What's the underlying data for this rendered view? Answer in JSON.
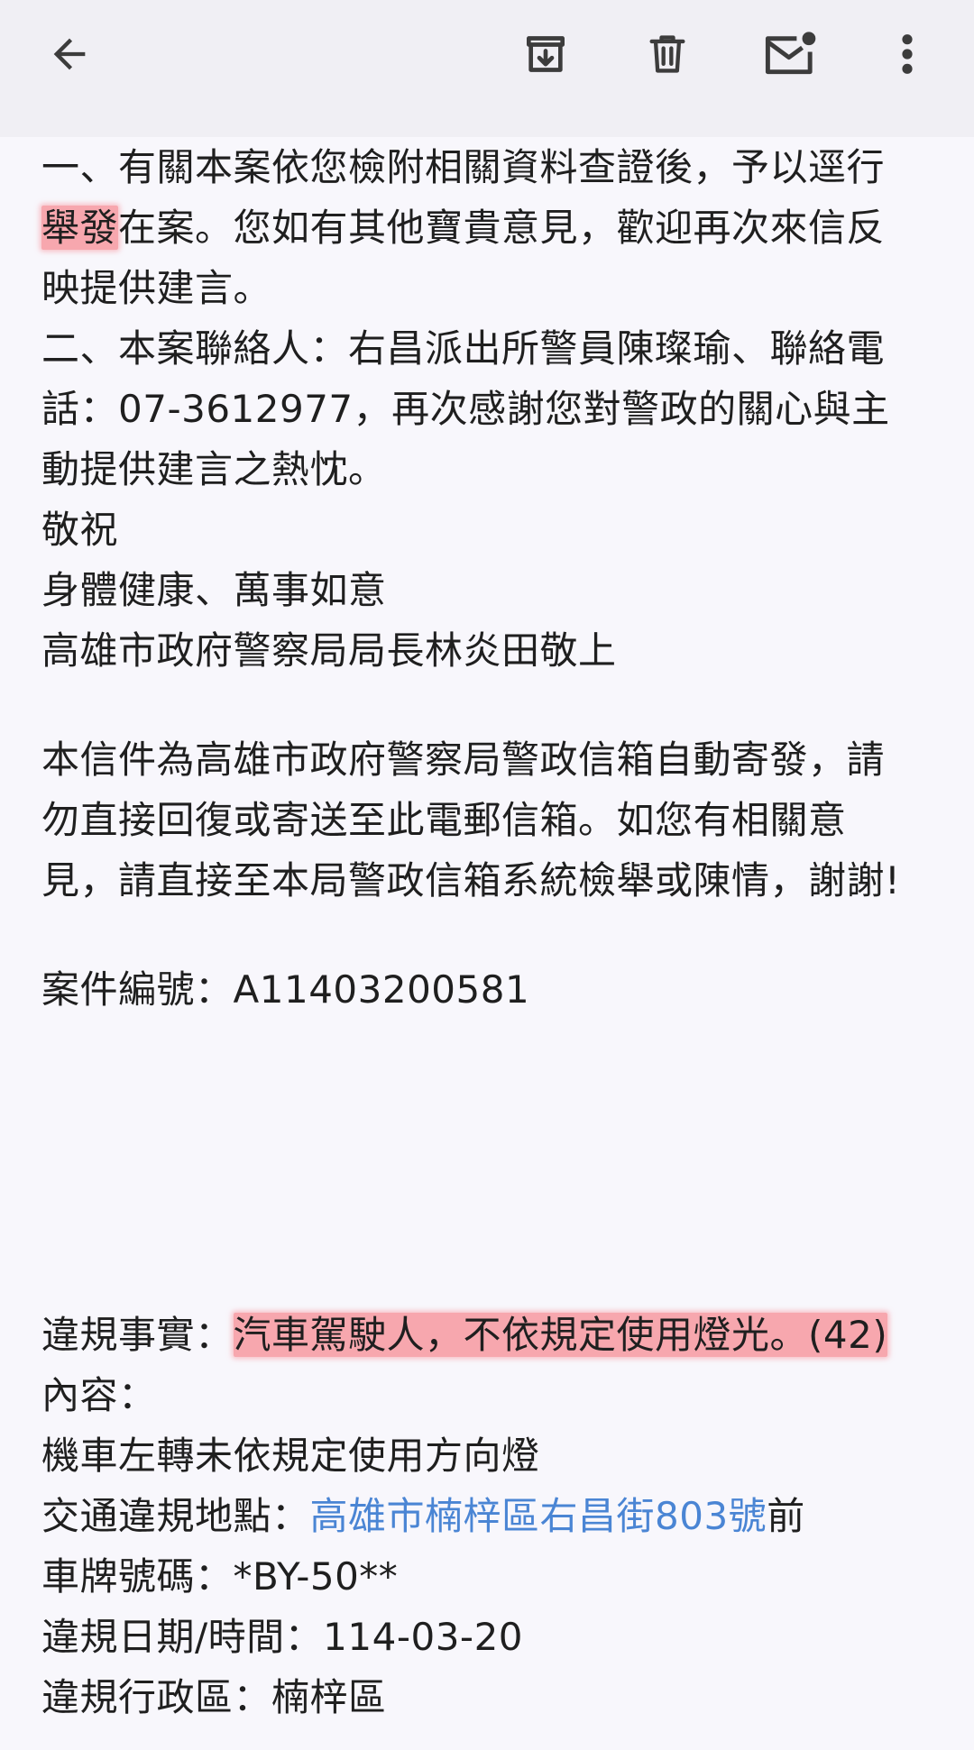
{
  "toolbar": {
    "back_icon": "arrow-left-icon",
    "archive_icon": "archive-icon",
    "delete_icon": "trash-icon",
    "mark_unread_icon": "mail-unread-icon",
    "more_icon": "more-vert-icon"
  },
  "colors": {
    "toolbar_bg": "#f0eff4",
    "page_bg": "#f8f7fc",
    "highlight": "#f7a7ae",
    "link": "#4a85d4"
  },
  "body": {
    "p1_line1": "一、有關本案依您檢附相關資料查證後，予以逕行",
    "p1_line2_hl": "舉發",
    "p1_line2_rest": "在案。您如有其他寶貴意見，歡迎再次來信反",
    "p1_line3": "映提供建言。",
    "p2_line1": "二、本案聯絡人：右昌派出所警員陳璨瑜、聯絡電",
    "p2_line2": "話：07-3612977，再次感謝您對警政的關心與主",
    "p2_line3": "動提供建言之熱忱。",
    "closing1": "敬祝",
    "closing2": "身體健康、萬事如意",
    "signature": "高雄市政府警察局局長林炎田敬上",
    "notice_line1": "本信件為高雄市政府警察局警政信箱自動寄發，請",
    "notice_line2": "勿直接回復或寄送至此電郵信箱。如您有相關意",
    "notice_line3": "見，請直接至本局警政信箱系統檢舉或陳情，謝謝!",
    "case_number_label": "案件編號：",
    "case_number": "A11403200581",
    "violation_fact_label": "違規事實：",
    "violation_fact": "汽車駕駛人，不依規定使用燈光。(42)",
    "content_label": "內容：",
    "content_text": "機車左轉未依規定使用方向燈",
    "location_label": "交通違規地點：",
    "location_link": "高雄市楠梓區右昌街803號",
    "location_suffix": "前",
    "plate_label": "車牌號碼：",
    "plate": "*BY-50**",
    "date_label": "違規日期/時間：",
    "date": "114-03-20",
    "district_label": "違規行政區：",
    "district": "楠梓區"
  }
}
